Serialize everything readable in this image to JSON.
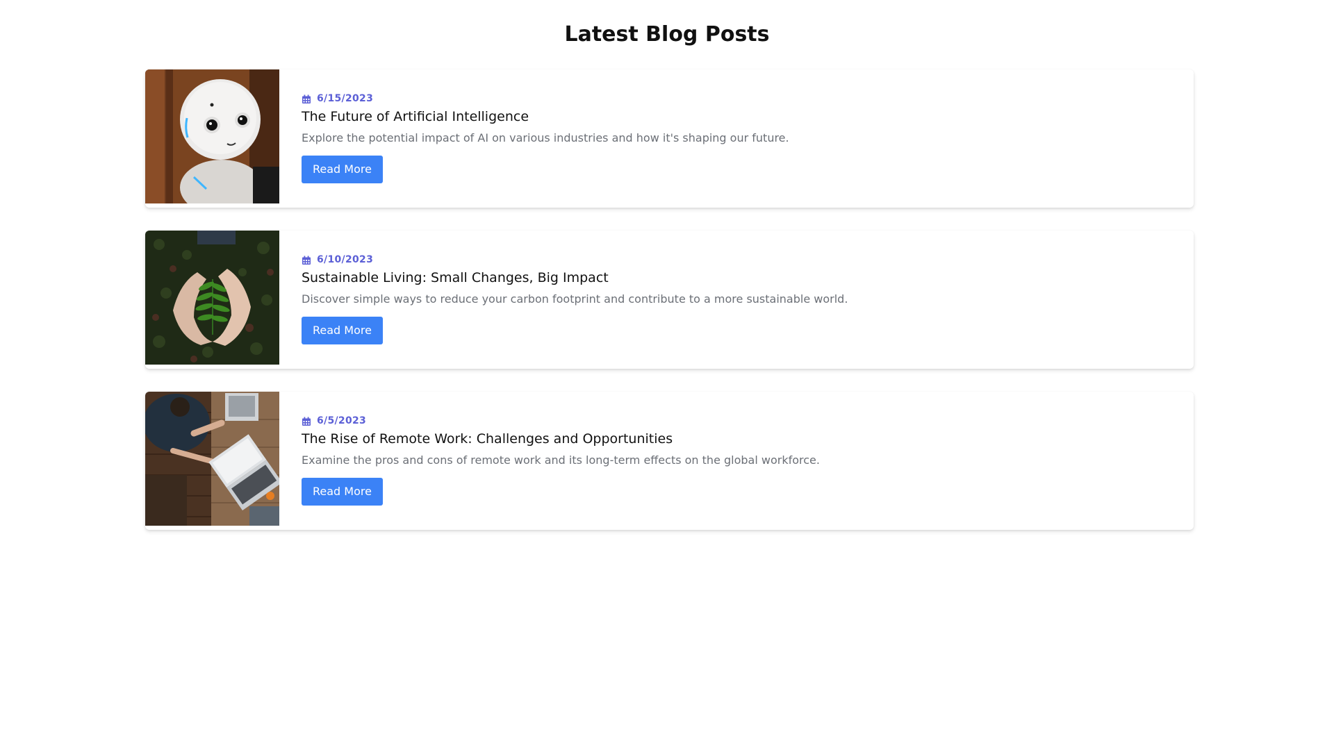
{
  "page": {
    "title": "Latest Blog Posts"
  },
  "posts": [
    {
      "date": "6/15/2023",
      "title": "The Future of Artificial Intelligence",
      "excerpt": "Explore the potential impact of AI on various industries and how it's shaping our future.",
      "button_label": "Read More",
      "image_subject": "robot"
    },
    {
      "date": "6/10/2023",
      "title": "Sustainable Living: Small Changes, Big Impact",
      "excerpt": "Discover simple ways to reduce your carbon footprint and contribute to a more sustainable world.",
      "button_label": "Read More",
      "image_subject": "hands-holding-fern"
    },
    {
      "date": "6/5/2023",
      "title": "The Rise of Remote Work: Challenges and Opportunities",
      "excerpt": "Examine the pros and cons of remote work and its long-term effects on the global workforce.",
      "button_label": "Read More",
      "image_subject": "people-working-on-laptops"
    }
  ],
  "colors": {
    "accent_date": "#5b5fd6",
    "button_bg": "#3b82f6",
    "excerpt_text": "#6b6f76"
  },
  "icons": {
    "date": "calendar-icon"
  }
}
